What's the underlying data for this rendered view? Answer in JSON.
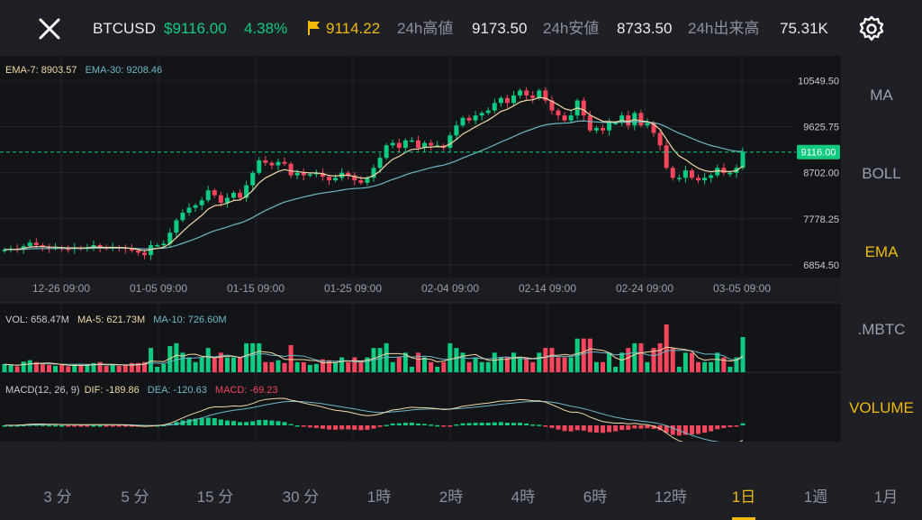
{
  "header": {
    "symbol": "BTCUSD",
    "last_price": "$9116.00",
    "change_pct": "4.38%",
    "mark_price": "9114.22",
    "high_label": "24h高値",
    "high_value": "9173.50",
    "low_label": "24h安値",
    "low_value": "8733.50",
    "volume_label": "24h出来高",
    "volume_value": "75.31K"
  },
  "indicators": {
    "ema": "EMA-7: 8903.57  EMA-30: 9208.46",
    "ema7": "EMA-7: 8903.57",
    "ema30": "EMA-30: 9208.46",
    "vol": "VOL: 658.47M",
    "ma5": "MA-5: 621.73M",
    "ma10": "MA-10: 726.60M",
    "macd_label": "MACD(12, 26, 9)",
    "dif": "DIF: -189.86",
    "dea": "DEA: -120.63",
    "macd": "MACD: -69.23"
  },
  "chart_data": {
    "type": "candlestick",
    "price_axis_ticks": [
      "10549.50",
      "9625.75",
      "8702.00",
      "7778.25",
      "6854.50"
    ],
    "current_price_tag": "9116.00",
    "x_tick_labels": [
      "12-26 09:00",
      "01-05 09:00",
      "01-15 09:00",
      "01-25 09:00",
      "02-04 09:00",
      "02-14 09:00",
      "02-24 09:00",
      "03-05 09:00"
    ],
    "y_range": [
      6600,
      10900
    ],
    "close_series": [
      7160,
      7180,
      7175,
      7230,
      7300,
      7250,
      7210,
      7190,
      7200,
      7180,
      7175,
      7200,
      7180,
      7210,
      7250,
      7200,
      7190,
      7210,
      7200,
      7180,
      7140,
      7100,
      7050,
      7250,
      7250,
      7280,
      7500,
      7750,
      7900,
      8000,
      8050,
      8150,
      8350,
      8250,
      8100,
      8200,
      8300,
      8200,
      8450,
      8700,
      8950,
      8900,
      8850,
      8920,
      8880,
      8650,
      8700,
      8650,
      8670,
      8700,
      8620,
      8550,
      8600,
      8700,
      8650,
      8550,
      8500,
      8600,
      8800,
      9000,
      9250,
      9300,
      9200,
      9350,
      9350,
      9200,
      9300,
      9250,
      9250,
      9200,
      9450,
      9650,
      9800,
      9750,
      9850,
      9900,
      9950,
      10100,
      10200,
      10100,
      10250,
      10350,
      10250,
      10200,
      10350,
      10150,
      9950,
      9850,
      9750,
      9850,
      10150,
      9850,
      9550,
      9600,
      9550,
      9700,
      9700,
      9850,
      9650,
      9900,
      9650,
      9700,
      9500,
      9250,
      8800,
      8600,
      8600,
      8750,
      8600,
      8550,
      8600,
      8650,
      8800,
      8700,
      8700,
      8800,
      9116
    ],
    "colors": {
      "up": "#0ecb81",
      "down": "#f6465d",
      "ema7": "#f3d9a4",
      "ema30": "#6cb8c6"
    }
  },
  "sidebar": {
    "items": [
      "MA",
      "BOLL",
      "EMA",
      ".MBTC",
      "VOLUME"
    ]
  },
  "timeframes": [
    "3 分",
    "5 分",
    "15 分",
    "30 分",
    "1時",
    "2時",
    "4時",
    "6時",
    "12時",
    "1日",
    "1週",
    "1月"
  ]
}
